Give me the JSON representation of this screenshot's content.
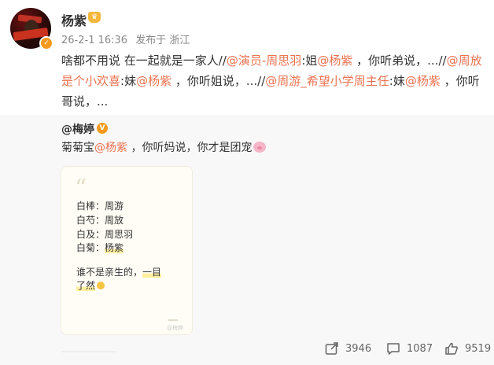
{
  "post": {
    "author": "杨紫",
    "date": "26-2-1 16:36",
    "source": "发布于 浙江",
    "body_segments": [
      {
        "t": "啥都不用说 在一起就是一家人//",
        "a": false
      },
      {
        "t": "@演员-周思羽",
        "a": true
      },
      {
        "t": ":姐",
        "a": false
      },
      {
        "t": "@杨紫",
        "a": true
      },
      {
        "t": " ，你听弟说，...//",
        "a": false
      },
      {
        "t": "@周放是个小欢喜",
        "a": true
      },
      {
        "t": ":妹",
        "a": false
      },
      {
        "t": "@杨紫",
        "a": true
      },
      {
        "t": " ，你听姐说，...//",
        "a": false
      },
      {
        "t": "@周游_希望小学周主任",
        "a": true
      },
      {
        "t": ":妹",
        "a": false
      },
      {
        "t": "@杨紫",
        "a": true
      },
      {
        "t": " ，你听哥说，...",
        "a": false
      }
    ]
  },
  "quoted": {
    "author": "@梅婷",
    "text_prefix": "菊菊宝",
    "mention": "@杨紫",
    "text_suffix": " ，你听妈说，你才是团宠"
  },
  "card": {
    "lines": [
      {
        "k": "白棒：",
        "v": "周游"
      },
      {
        "k": "白芍：",
        "v": "周放"
      },
      {
        "k": "白及：",
        "v": "周思羽"
      },
      {
        "k": "白菊：",
        "v": "杨紫"
      }
    ],
    "line5a": "谁不是亲生的，",
    "line5b": "一目",
    "line6": "了然",
    "watermark": "@梅婷"
  },
  "actions": {
    "repost_count": "3946",
    "comment_count": "1087",
    "like_count": "9519"
  },
  "colors": {
    "accent": "#eb7350",
    "verified": "#f39a1e",
    "quote_bg": "#f8f8f8"
  }
}
